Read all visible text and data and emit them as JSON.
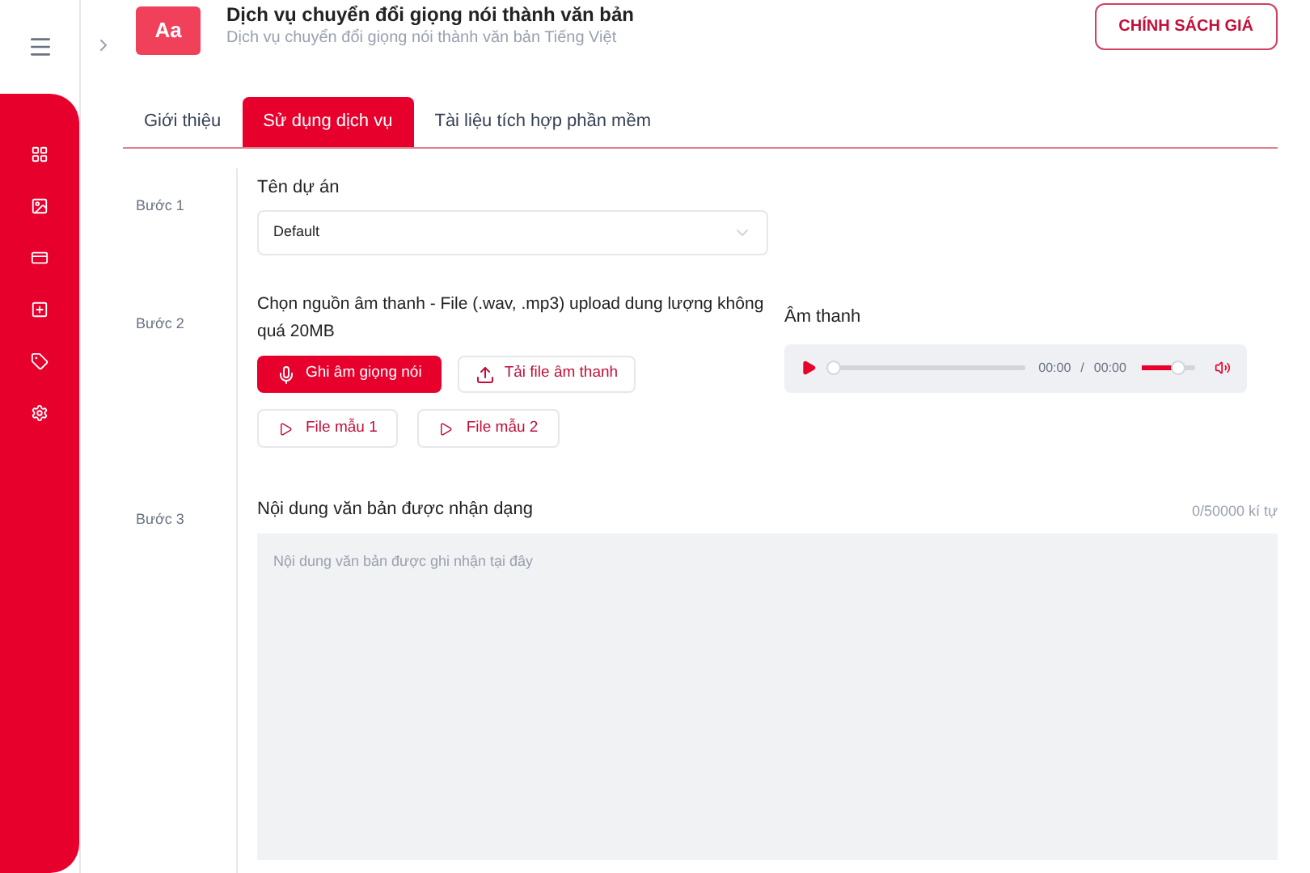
{
  "header": {
    "title": "Dịch vụ chuyển đổi giọng nói thành văn bản",
    "subtitle": "Dịch vụ chuyển đổi giọng nói thành văn bản Tiếng Việt",
    "logo_text": "Aa",
    "pricing_button": "CHÍNH SÁCH GIÁ"
  },
  "sidebar": {
    "items": [
      {
        "kind": "grid"
      },
      {
        "kind": "image"
      },
      {
        "kind": "card"
      },
      {
        "kind": "plus"
      },
      {
        "kind": "tag"
      },
      {
        "kind": "gear"
      }
    ]
  },
  "tabs": [
    {
      "label": "Giới thiệu",
      "selected": false
    },
    {
      "label": "Sử dụng dịch vụ",
      "selected": true
    },
    {
      "label": "Tài liệu tích hợp phần mềm",
      "selected": false
    }
  ],
  "step1": {
    "step": "Bước 1",
    "label": "Tên dự án",
    "value": "Default"
  },
  "step2": {
    "step": "Bước 2",
    "label": "Chọn nguồn âm thanh - File (.wav, .mp3) upload dung lượng không quá 20MB",
    "record_button": "Ghi âm giọng nói",
    "upload_button": "Tải file âm thanh",
    "samples": [
      "File mẫu 1",
      "File mẫu 2"
    ],
    "player": {
      "label": "Âm thanh",
      "progress": {
        "level": 0
      },
      "current": "00:00",
      "separator": "/",
      "total": "00:00",
      "volume": {
        "level": 0.75
      }
    }
  },
  "step3": {
    "step": "Bước 3",
    "label": "Nội dung văn bản được nhận dạng",
    "counter": "0/50000 kí tự",
    "placeholder": "Nội dung văn bản được ghi nhận tại đây"
  }
}
